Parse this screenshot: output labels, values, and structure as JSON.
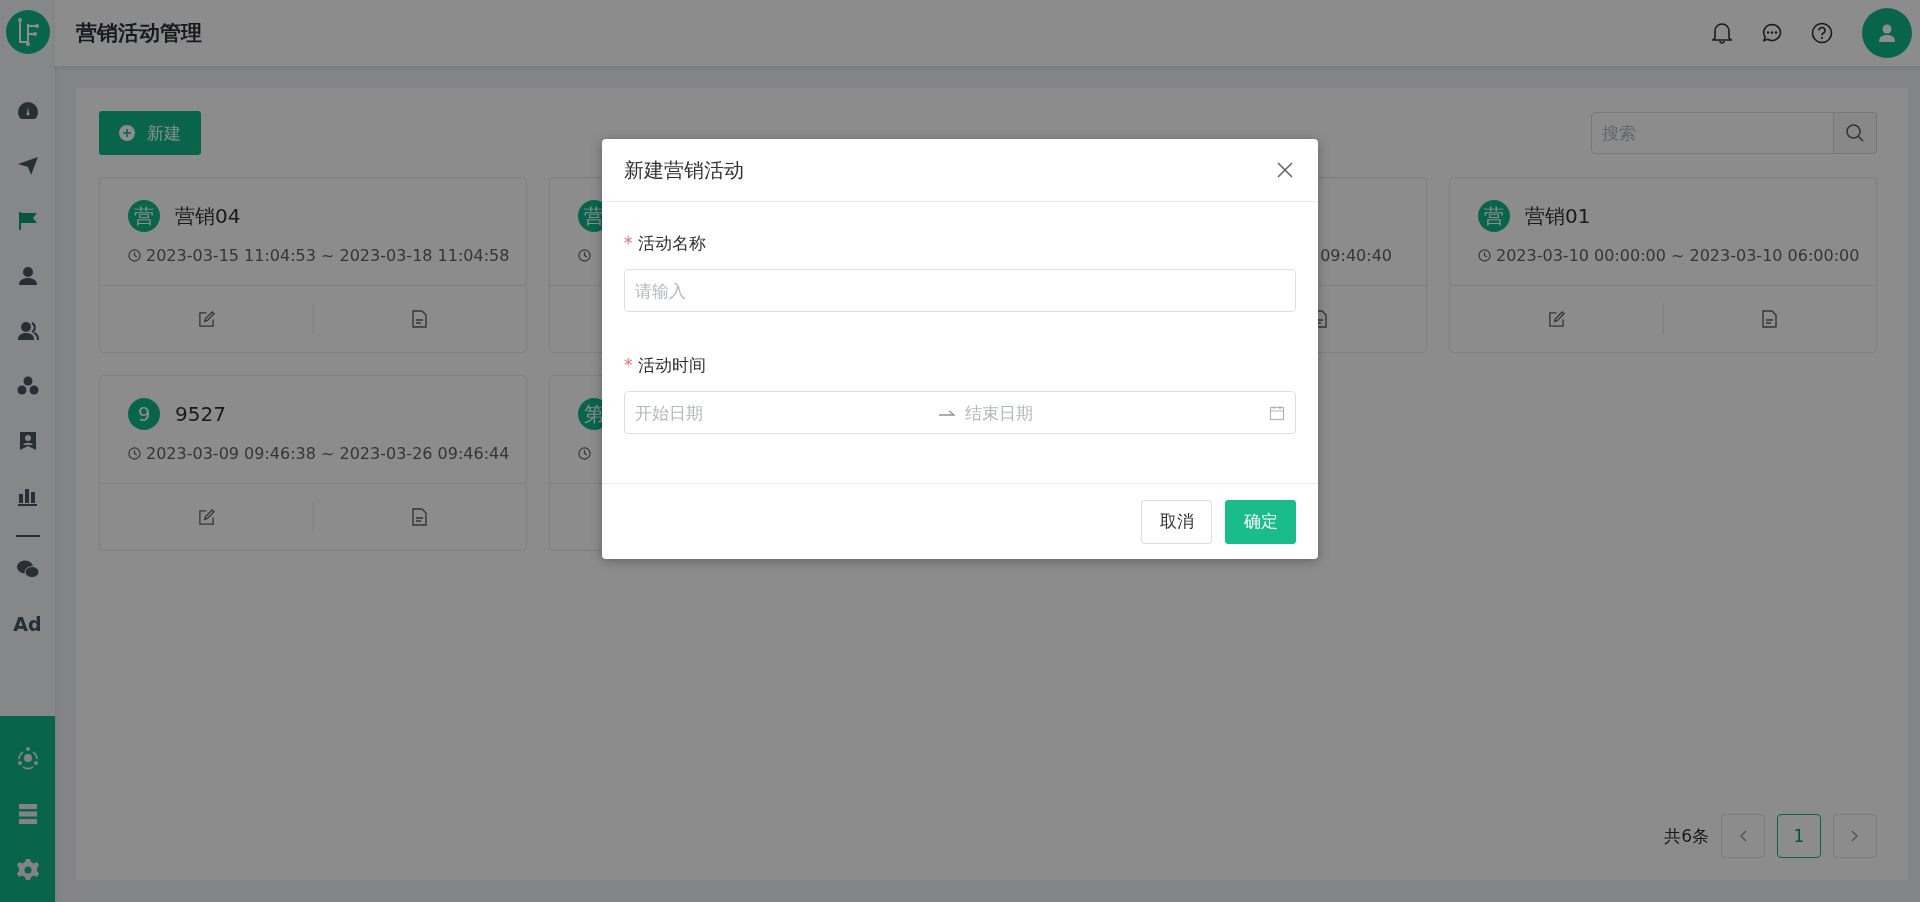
{
  "header": {
    "title": "营销活动管理"
  },
  "sidebar": {
    "items": [
      {
        "selected": false
      },
      {
        "selected": false
      },
      {
        "selected": true
      },
      {
        "selected": false
      },
      {
        "selected": false
      },
      {
        "selected": false
      },
      {
        "selected": false
      },
      {
        "selected": false
      },
      {
        "selected": false
      },
      {
        "selected": false,
        "label": "Ad"
      }
    ]
  },
  "toolbar": {
    "new_button": "新建",
    "search": {
      "placeholder": "搜索"
    }
  },
  "cards": [
    {
      "avatar": "营",
      "name": "营销04",
      "date": "2023-03-15 11:04:53 ~ 2023-03-18 11:04:58",
      "actions": [
        {
          "kind": "edit"
        },
        {
          "kind": "details"
        }
      ]
    },
    {
      "avatar": "营"
    },
    {
      "date": "09:40:40",
      "actions": [
        {
          "kind": "details"
        }
      ]
    },
    {
      "avatar": "营",
      "name": "营销01",
      "date": "2023-03-10 00:00:00 ~ 2023-03-10 06:00:00",
      "actions": [
        {
          "kind": "edit"
        },
        {
          "kind": "details"
        }
      ]
    },
    {
      "avatar": "9",
      "name": "9527",
      "date": "2023-03-09 09:46:38 ~ 2023-03-26 09:46:44",
      "actions": [
        {
          "kind": "edit"
        },
        {
          "kind": "details"
        }
      ]
    },
    {
      "avatar": "第"
    }
  ],
  "pagination": {
    "total": "共6条",
    "pages": [
      {
        "label": "1",
        "selected": true
      }
    ]
  },
  "dialog": {
    "title": "新建营销活动",
    "fields": [
      {
        "kind": "text",
        "label": "活动名称",
        "required_mark": "*",
        "placeholder": "请输入"
      },
      {
        "kind": "range",
        "label": "活动时间",
        "required_mark": "*",
        "start_placeholder": "开始日期",
        "end_placeholder": "结束日期"
      }
    ],
    "buttons": [
      {
        "label": "取消",
        "primary": false
      },
      {
        "label": "确定",
        "primary": true
      }
    ]
  }
}
